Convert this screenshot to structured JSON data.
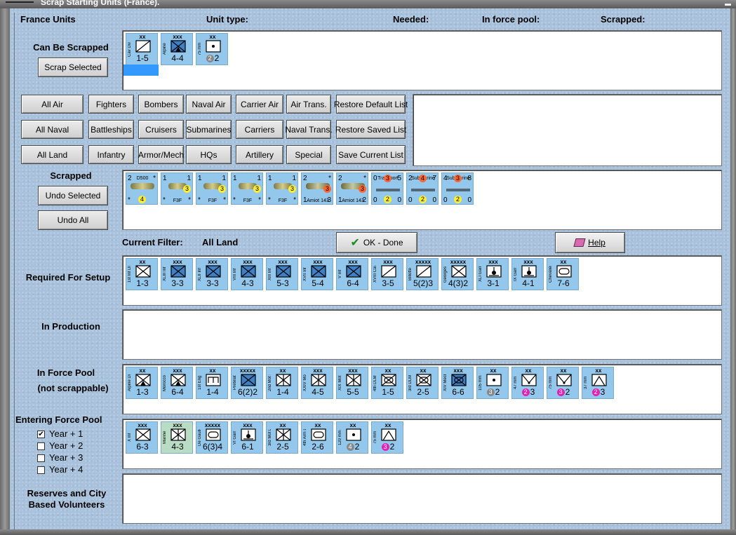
{
  "window": {
    "title": "Scrap Starting Units (France)."
  },
  "headers": {
    "units": "France Units",
    "unit_type": "Unit type:",
    "needed": "Needed:",
    "in_force_pool": "In force pool:",
    "scrapped": "Scrapped:"
  },
  "sections": {
    "can_be_scrapped": "Can Be Scrapped",
    "scrapped": "Scrapped",
    "current_filter_label": "Current Filter:",
    "current_filter_value": "All Land",
    "required": "Required For Setup",
    "in_production": "In Production",
    "in_force_pool_1": "In Force Pool",
    "in_force_pool_2": "(not scrappable)",
    "entering": "Entering Force Pool",
    "reserves_1": "Reserves and City",
    "reserves_2": "Based Volunteers"
  },
  "buttons": {
    "scrap_selected": "Scrap Selected",
    "undo_selected": "Undo Selected",
    "undo_all": "Undo All",
    "ok_done": "OK - Done",
    "help": "Help"
  },
  "filters": [
    [
      "All Air",
      "Fighters",
      "Bombers",
      "Naval Air",
      "Carrier Air",
      "Air Trans.",
      "Restore Default List"
    ],
    [
      "All Naval",
      "Battleships",
      "Cruisers",
      "Submarines",
      "Carriers",
      "Naval Trans.",
      "Restore Saved List"
    ],
    [
      "All Land",
      "Infantry",
      "Armor/Mech",
      "HQs",
      "Artillery",
      "Special",
      "Save Current List"
    ]
  ],
  "years": [
    {
      "label": "Year + 1",
      "checked": true
    },
    {
      "label": "Year + 2",
      "checked": false
    },
    {
      "label": "Year + 3",
      "checked": false
    },
    {
      "label": "Year + 4",
      "checked": false
    }
  ],
  "can_be_scrapped_units": [
    {
      "size": "xx",
      "name": "Cav Div",
      "sym": "cav",
      "str": "1-5"
    },
    {
      "size": "xxx",
      "name": "Alpine",
      "sym": "mtn",
      "str": "4-4",
      "fill": true
    },
    {
      "size": "xx",
      "name": "75 mm",
      "sym": "art",
      "str": "2",
      "circle": "2",
      "circle_color": "#888888"
    }
  ],
  "scrapped_units": [
    {
      "tl": "2",
      "tr": "*",
      "sub": "D500",
      "bl": "*",
      "br": "",
      "badge": "4",
      "badge_color": "#ffee33"
    },
    {
      "tl": "1",
      "tr": "1",
      "sub": "",
      "bl": "*",
      "br": "*",
      "name": "F3F",
      "badge": "3",
      "badge_color": "#ffee33"
    },
    {
      "tl": "1",
      "tr": "1",
      "sub": "",
      "bl": "*",
      "br": "*",
      "name": "F3F",
      "badge": "3",
      "badge_color": "#ffee33"
    },
    {
      "tl": "1",
      "tr": "1",
      "sub": "",
      "bl": "*",
      "br": "*",
      "name": "F3F",
      "badge": "3",
      "badge_color": "#ffee33"
    },
    {
      "tl": "1",
      "tr": "1",
      "sub": "",
      "bl": "*",
      "br": "*",
      "name": "F3F",
      "badge": "3",
      "badge_color": "#ffee33"
    },
    {
      "tl": "2",
      "tr": "*",
      "sub": "",
      "bl": "1",
      "br": "3",
      "name": "Amiot 143",
      "badge": "3",
      "badge_color": "#ff6633"
    },
    {
      "tl": "2",
      "tr": "*",
      "sub": "",
      "bl": "1",
      "br": "2",
      "name": "Amiot 143",
      "badge": "3",
      "badge_color": "#ff6633"
    },
    {
      "tl": "0",
      "tr": "5",
      "sub": "Transport",
      "bl": "0",
      "br": "0",
      "badge_top": "3",
      "badge": "2",
      "badge_color": "#ffee33"
    },
    {
      "tl": "2",
      "tr": "7",
      "sub": "Submarine",
      "bl": "0",
      "br": "0",
      "badge_top": "4",
      "badge": "2",
      "badge_color": "#ffee33"
    },
    {
      "tl": "4",
      "tr": "8",
      "sub": "Submarine",
      "bl": "0",
      "br": "0",
      "badge_top": "3",
      "badge": "2",
      "badge_color": "#ffee33"
    }
  ],
  "required_units": [
    {
      "size": "xx",
      "name": "1st Inf Div",
      "sym": "inf",
      "str": "1-3"
    },
    {
      "size": "xxx",
      "name": "XLIII Inf",
      "sym": "inf",
      "str": "3-3",
      "fill": true
    },
    {
      "size": "xxx",
      "name": "XLII Inf",
      "sym": "inf",
      "str": "3-3",
      "fill": true
    },
    {
      "size": "xxx",
      "name": "VIII Inf",
      "sym": "inf",
      "str": "4-3",
      "fill": true
    },
    {
      "size": "xxx",
      "name": "XIII Inf",
      "sym": "inf",
      "str": "5-3",
      "fill": true
    },
    {
      "size": "xxx",
      "name": "XVII Inf",
      "sym": "inf",
      "str": "5-4",
      "fill": true
    },
    {
      "size": "xxx",
      "name": "V Inf",
      "sym": "inf",
      "str": "6-4",
      "fill": true
    },
    {
      "size": "xxx",
      "name": "XVIII Cav",
      "sym": "cav",
      "str": "3-5"
    },
    {
      "size": "xxxxx",
      "name": "Billotte",
      "sym": "hq",
      "str": "5(2)3"
    },
    {
      "size": "xxxxx",
      "name": "Georges",
      "sym": "inf",
      "str": "4(3)2"
    },
    {
      "size": "xxx",
      "name": "XLI Garr",
      "sym": "garr",
      "str": "3-1"
    },
    {
      "size": "xxx",
      "name": "IX Garr",
      "sym": "garr",
      "str": "4-1"
    },
    {
      "size": "xx",
      "name": "Chevalier",
      "sym": "arm",
      "str": "7-6"
    }
  ],
  "force_pool_units": [
    {
      "size": "xx",
      "name": "Alpine Div",
      "sym": "mtn",
      "str": "1-3"
    },
    {
      "size": "xxx",
      "name": "Morocco",
      "sym": "mtn",
      "str": "6-4"
    },
    {
      "size": "xx",
      "name": "1st Eng",
      "sym": "eng",
      "str": "1-4"
    },
    {
      "size": "xxxxx",
      "name": "Pretelat",
      "sym": "inf",
      "str": "6(2)2",
      "fill": true
    },
    {
      "size": "xx",
      "name": "2nd Mot Div",
      "sym": "mot",
      "str": "1-4"
    },
    {
      "size": "xxx",
      "name": "XXIV Mot",
      "sym": "mot",
      "str": "4-5"
    },
    {
      "size": "xxx",
      "name": "XIX Mot",
      "sym": "mot",
      "str": "5-5"
    },
    {
      "size": "xx",
      "name": "4th DLM Div",
      "sym": "mech",
      "str": "1-5"
    },
    {
      "size": "xx",
      "name": "3rd DLM Div",
      "sym": "mech",
      "str": "2-5"
    },
    {
      "size": "xxx",
      "name": "XIV Mech",
      "sym": "mech",
      "str": "6-6",
      "fill": true
    },
    {
      "size": "xx",
      "name": "105 mm",
      "sym": "art",
      "str": "2",
      "circle": "3",
      "circle_color": "#888888"
    },
    {
      "size": "xx",
      "name": "47 mm",
      "sym": "at",
      "str": "3",
      "circle": "2",
      "circle_color": "#e61fb5"
    },
    {
      "size": "xx",
      "name": "75 mm",
      "sym": "at",
      "str": "2",
      "circle": "3",
      "circle_color": "#e61fb5"
    },
    {
      "size": "xx",
      "name": "37 mm",
      "sym": "aa",
      "str": "3",
      "circle": "2",
      "circle_color": "#e61fb5"
    }
  ],
  "entering_units": [
    {
      "size": "xxx",
      "name": "X Inf",
      "sym": "inf",
      "str": "6-3"
    },
    {
      "size": "xxx",
      "name": "Marine",
      "sym": "marine",
      "str": "4-3",
      "green": true
    },
    {
      "size": "xxxxx",
      "name": "De Gaulle",
      "sym": "arm",
      "str": "6(3)4"
    },
    {
      "size": "xxx",
      "name": "VI Garr",
      "sym": "garr",
      "str": "6-1"
    },
    {
      "size": "xx",
      "name": "3rd Mot Div",
      "sym": "mot",
      "str": "2-5"
    },
    {
      "size": "xx",
      "name": "4th Arm Div",
      "sym": "arm",
      "str": "2-6"
    },
    {
      "size": "xx",
      "name": "120 mm",
      "sym": "art",
      "str": "2",
      "circle": "4",
      "circle_color": "#888888"
    },
    {
      "size": "xx",
      "name": "75 mm",
      "sym": "aa",
      "str": "2",
      "circle": "3",
      "circle_color": "#e61fb5"
    }
  ]
}
